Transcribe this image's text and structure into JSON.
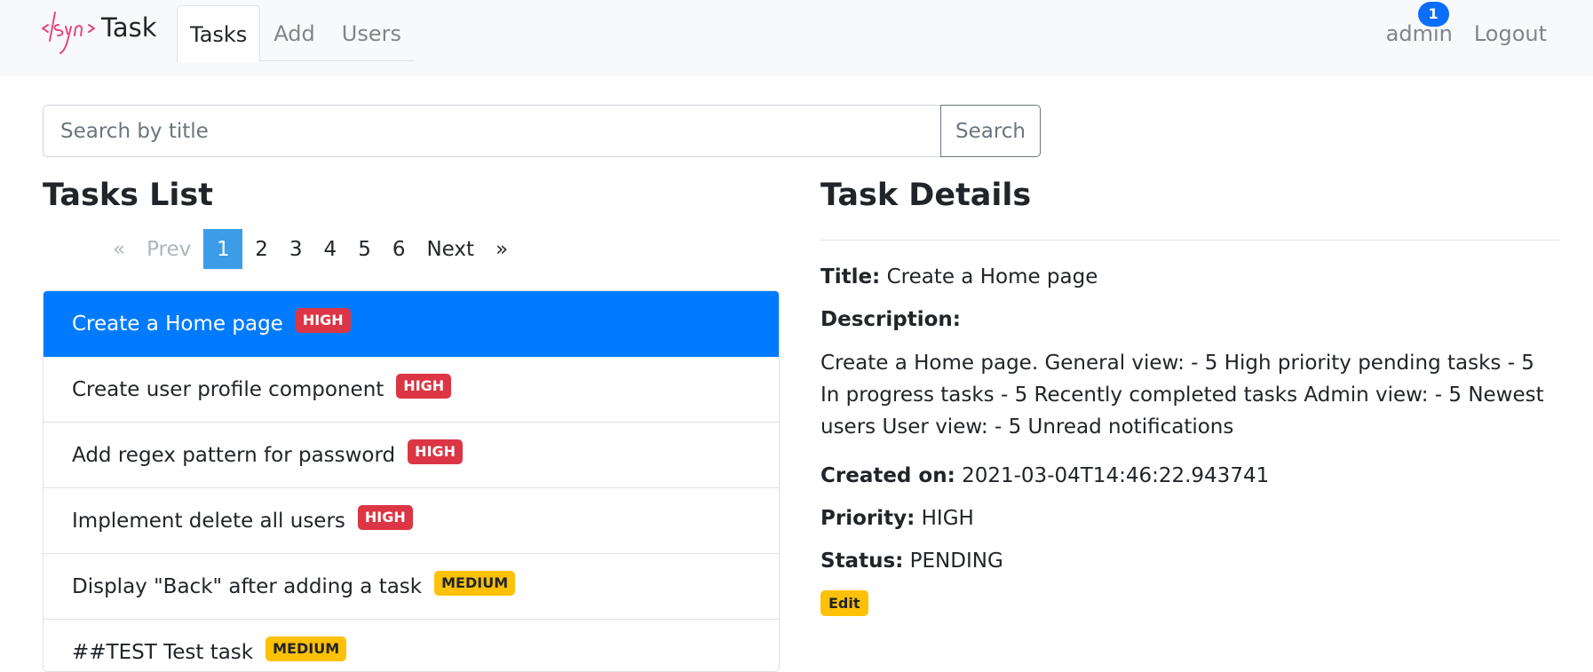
{
  "navbar": {
    "brand_text": "Task",
    "logo_icon": "syn-logo-icon",
    "tabs": [
      {
        "label": "Tasks",
        "active": true
      },
      {
        "label": "Add",
        "active": false
      },
      {
        "label": "Users",
        "active": false
      }
    ],
    "user": "admin",
    "notification_count": "1",
    "logout": "Logout"
  },
  "search": {
    "placeholder": "Search by title",
    "button": "Search"
  },
  "list": {
    "heading": "Tasks List",
    "pagination": {
      "prev": "«",
      "prev_label": "Prev",
      "pages": [
        "1",
        "2",
        "3",
        "4",
        "5",
        "6"
      ],
      "active_page": "1",
      "next_label": "Next",
      "next": "»"
    },
    "items": [
      {
        "title": "Create a Home page",
        "priority": "HIGH",
        "active": true
      },
      {
        "title": "Create user profile component",
        "priority": "HIGH",
        "active": false
      },
      {
        "title": "Add regex pattern for password",
        "priority": "HIGH",
        "active": false
      },
      {
        "title": "Implement delete all users",
        "priority": "HIGH",
        "active": false
      },
      {
        "title": "Display \"Back\" after adding a task",
        "priority": "MEDIUM",
        "active": false
      },
      {
        "title": "##TEST Test task",
        "priority": "MEDIUM",
        "active": false
      }
    ]
  },
  "details": {
    "heading": "Task Details",
    "title_label": "Title:",
    "title_value": "Create a Home page",
    "description_label": "Description:",
    "description_value": "Create a Home page. General view: - 5 High priority pending tasks - 5 In progress tasks - 5 Recently completed tasks Admin view: - 5 Newest users User view: - 5 Unread notifications",
    "created_label": "Created on:",
    "created_value": "2021-03-04T14:46:22.943741",
    "priority_label": "Priority:",
    "priority_value": "HIGH",
    "status_label": "Status:",
    "status_value": "PENDING",
    "edit": "Edit"
  },
  "colors": {
    "active_item": "#007bff",
    "high_badge": "#dc3545",
    "medium_badge": "#ffc107",
    "active_page": "#3b9de8",
    "notification_badge": "#0d6efd",
    "logo": "#e8457a"
  }
}
